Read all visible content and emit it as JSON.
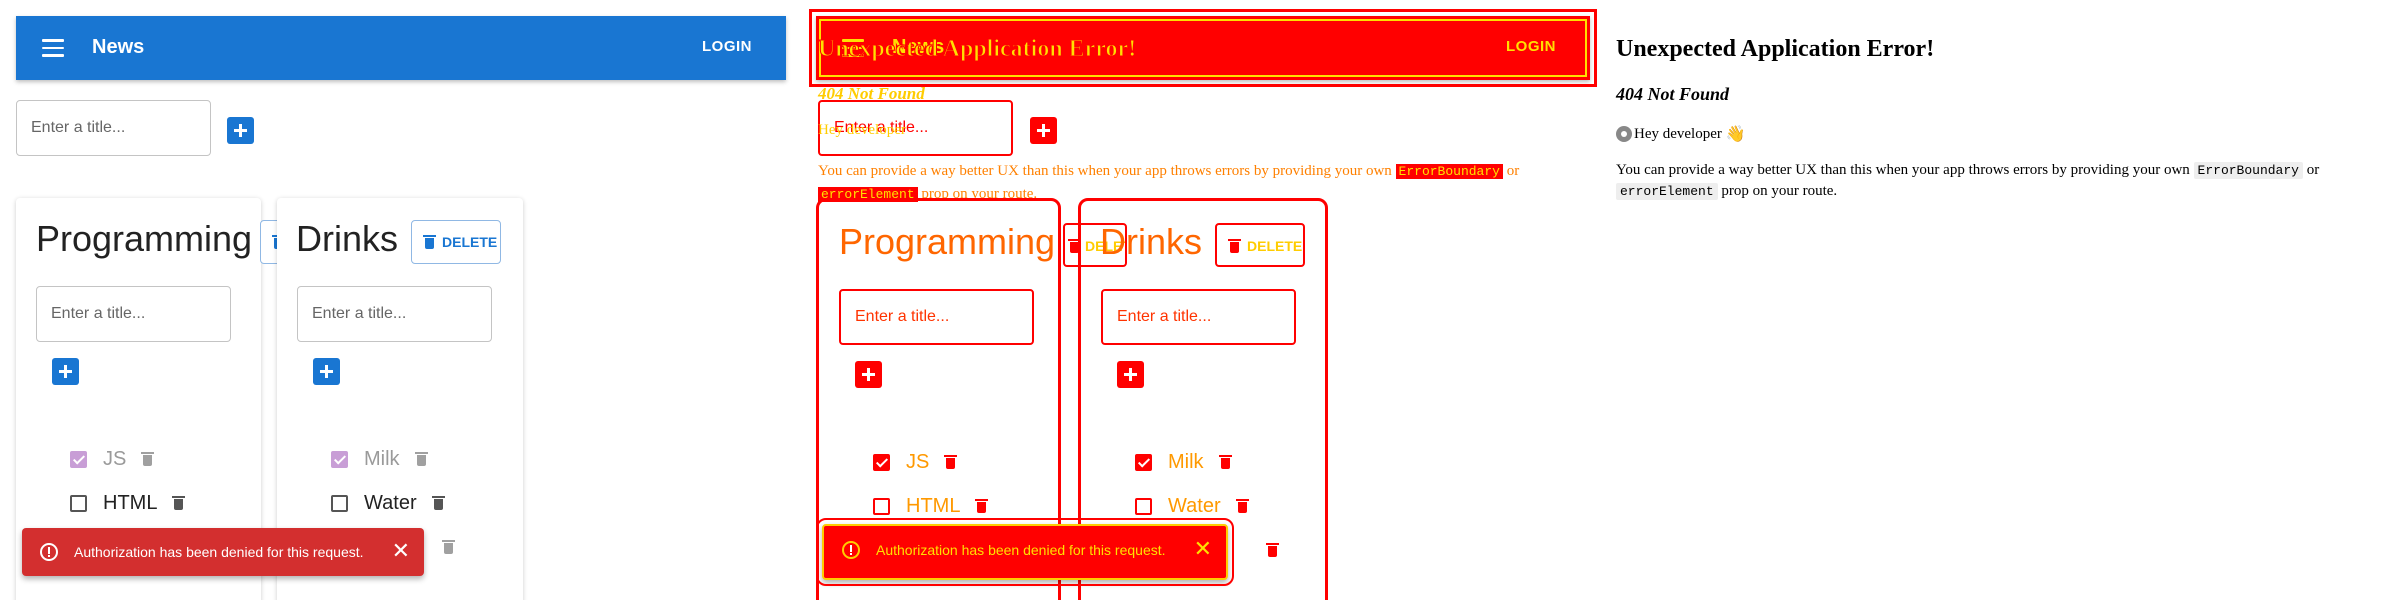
{
  "app": {
    "title": "News",
    "login_label": "LOGIN",
    "new_list_placeholder": "Enter a title...",
    "delete_label": "DELETE",
    "task_placeholder": "Enter a title...",
    "colors": {
      "primary": "#1976d2",
      "error": "#d32f2f",
      "checked": "#c89ed6"
    }
  },
  "lists": [
    {
      "title": "Programming",
      "tasks": [
        {
          "label": "JS",
          "done": true
        },
        {
          "label": "HTML",
          "done": false
        }
      ]
    },
    {
      "title": "Drinks",
      "tasks": [
        {
          "label": "Milk",
          "done": true
        },
        {
          "label": "Water",
          "done": false
        }
      ]
    }
  ],
  "snackbar": {
    "message": "Authorization has been denied for this request.",
    "close_glyph": "✕"
  },
  "error_page": {
    "title": "Unexpected Application Error!",
    "status": "404 Not Found",
    "hey": "Hey developer",
    "hey_emoji": "👋",
    "body_prefix": "You can provide a way better UX than this when your app throws errors by providing your own",
    "code1": "ErrorBoundary",
    "body_middle": "or",
    "code2": "errorElement",
    "body_suffix": "prop on your route."
  }
}
